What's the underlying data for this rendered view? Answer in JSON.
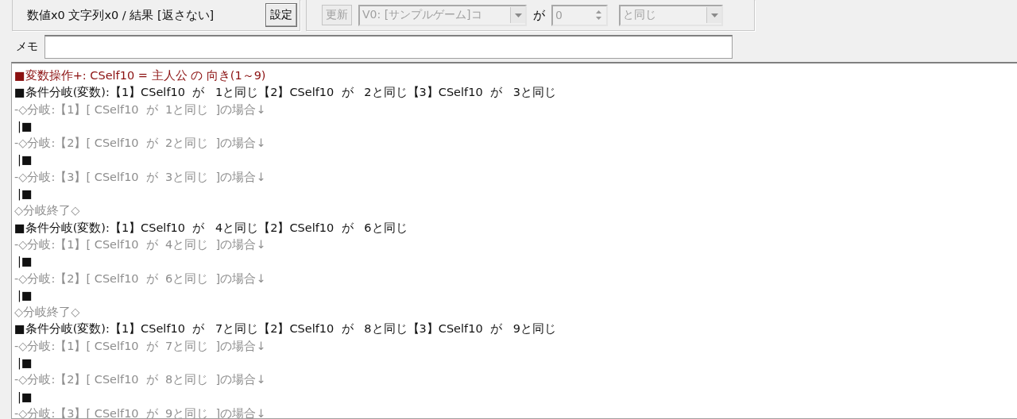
{
  "args_group": {
    "summary": "数値x0 文字列x0 / 結果 [返さない]",
    "button": "設定"
  },
  "condition_group": {
    "update_button": {
      "label": "更新",
      "disabled": true
    },
    "variable_combo": {
      "value": "V0: [サンプルゲーム]コ",
      "disabled": true
    },
    "ga_label": "が",
    "number_field": {
      "value": "0",
      "disabled": true
    },
    "compare_combo": {
      "value": "と同じ",
      "disabled": true
    }
  },
  "memo": {
    "label": "メモ"
  },
  "event_lines": [
    {
      "kind": "op",
      "text": "■変数操作+: CSelf10 = 主人公 の 向き(1～9)"
    },
    {
      "kind": "cond",
      "text": "■条件分岐(変数):【1】CSelf10  が   1と同じ【2】CSelf10  が   2と同じ【3】CSelf10  が   3と同じ"
    },
    {
      "kind": "branch",
      "text": "-◇分岐:【1】[ CSelf10  が  1と同じ  ]の場合↓"
    },
    {
      "kind": "body",
      "text": "|■"
    },
    {
      "kind": "branch",
      "text": "-◇分岐:【2】[ CSelf10  が  2と同じ  ]の場合↓"
    },
    {
      "kind": "body",
      "text": "|■"
    },
    {
      "kind": "branch",
      "text": "-◇分岐:【3】[ CSelf10  が  3と同じ  ]の場合↓"
    },
    {
      "kind": "body",
      "text": "|■"
    },
    {
      "kind": "end",
      "text": "◇分岐終了◇"
    },
    {
      "kind": "cond",
      "text": "■条件分岐(変数):【1】CSelf10  が   4と同じ【2】CSelf10  が   6と同じ"
    },
    {
      "kind": "branch",
      "text": "-◇分岐:【1】[ CSelf10  が  4と同じ  ]の場合↓"
    },
    {
      "kind": "body",
      "text": "|■"
    },
    {
      "kind": "branch",
      "text": "-◇分岐:【2】[ CSelf10  が  6と同じ  ]の場合↓"
    },
    {
      "kind": "body",
      "text": "|■"
    },
    {
      "kind": "end",
      "text": "◇分岐終了◇"
    },
    {
      "kind": "cond",
      "text": "■条件分岐(変数):【1】CSelf10  が   7と同じ【2】CSelf10  が   8と同じ【3】CSelf10  が   9と同じ"
    },
    {
      "kind": "branch",
      "text": "-◇分岐:【1】[ CSelf10  が  7と同じ  ]の場合↓"
    },
    {
      "kind": "body",
      "text": "|■"
    },
    {
      "kind": "branch",
      "text": "-◇分岐:【2】[ CSelf10  が  8と同じ  ]の場合↓"
    },
    {
      "kind": "body",
      "text": "|■"
    },
    {
      "kind": "branch",
      "text": "-◇分岐:【3】[ CSelf10  が  9と同じ  ]の場合↓"
    }
  ]
}
